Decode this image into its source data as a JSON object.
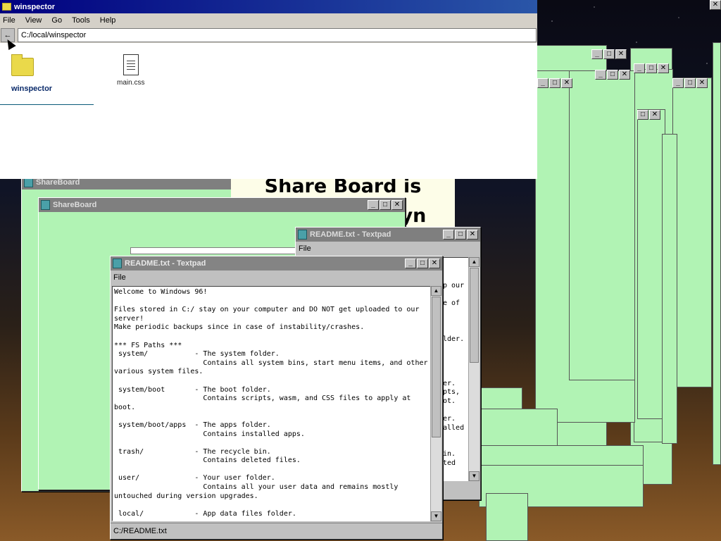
{
  "winspector": {
    "title": "winspector",
    "menu": [
      "File",
      "View",
      "Go",
      "Tools",
      "Help"
    ],
    "back_label": "←",
    "address": "C:/local/winspector",
    "items": [
      {
        "name": "winspector",
        "kind": "folder"
      },
      {
        "name": "main.css",
        "kind": "file"
      }
    ]
  },
  "shareboard_bg": {
    "title": "ShareBoard"
  },
  "shareboard_page": {
    "heading_line1": "Share Board is",
    "heading_line2": "yn"
  },
  "shareboard": {
    "title": "ShareBoard"
  },
  "textpad_back": {
    "title": "README.txt - Textpad",
    "menu": [
      "File"
    ],
    "visible_fragments": [
      "p our",
      "e of",
      "lder.",
      "er.",
      "pts,",
      "ot.",
      "er.",
      "alled",
      "in.",
      "ted"
    ]
  },
  "textpad_front": {
    "title": "README.txt - Textpad",
    "menu": [
      "File"
    ],
    "status": "C:/README.txt",
    "content": "Welcome to Windows 96!\n\nFiles stored in C:/ stay on your computer and DO NOT get uploaded to our\nserver!\nMake periodic backups since in case of instability/crashes.\n\n*** FS Paths ***\n system/           - The system folder.\n                     Contains all system bins, start menu items, and other\nvarious system files.\n\n system/boot       - The boot folder.\n                     Contains scripts, wasm, and CSS files to apply at\nboot.\n\n system/boot/apps  - The apps folder.\n                     Contains installed apps.\n\n trash/            - The recycle bin.\n                     Contains deleted files.\n\n user/             - Your user folder.\n                     Contains all your user data and remains mostly\nuntouched during version upgrades.\n\n local/            - App data files folder."
  },
  "window_controls": {
    "minimize": "_",
    "maximize": "□",
    "close": "✕"
  },
  "colors": {
    "window_bg": "#c0c0c0",
    "green_window": "#b1f3b4",
    "titlebar_inactive": "#7f7f7f",
    "winspector_titlebar": "#000080"
  }
}
